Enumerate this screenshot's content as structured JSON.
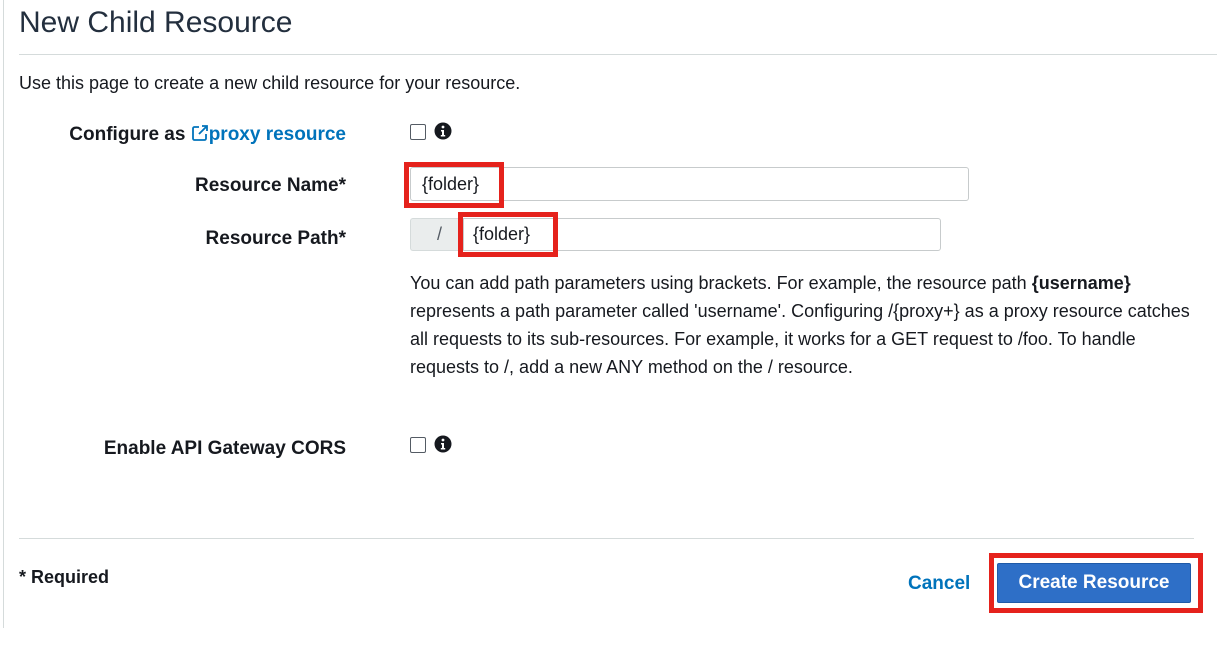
{
  "header": {
    "title": "New Child Resource",
    "intro": "Use this page to create a new child resource for your resource."
  },
  "form": {
    "proxy": {
      "label_prefix": "Configure as ",
      "link_text": "proxy resource",
      "checked": false
    },
    "resource_name": {
      "label": "Resource Name*",
      "value": "{folder}"
    },
    "resource_path": {
      "label": "Resource Path*",
      "prefix": "/",
      "value": "{folder}",
      "help_before": "You can add path parameters using brackets. For example, the resource path ",
      "help_bold": "{username}",
      "help_after": " represents a path parameter called 'username'. Configuring /{proxy+} as a proxy resource catches all requests to its sub-resources. For example, it works for a GET request to /foo. To handle requests to /, add a new ANY method on the / resource."
    },
    "cors": {
      "label": "Enable API Gateway CORS",
      "checked": false
    }
  },
  "footer": {
    "required_note": "* Required",
    "cancel_label": "Cancel",
    "create_label": "Create Resource"
  },
  "icons": [
    "external-link-icon",
    "info-icon"
  ],
  "colors": {
    "link": "#0073bb",
    "primary_button": "#2e6fc7",
    "highlight": "#e5221c"
  }
}
